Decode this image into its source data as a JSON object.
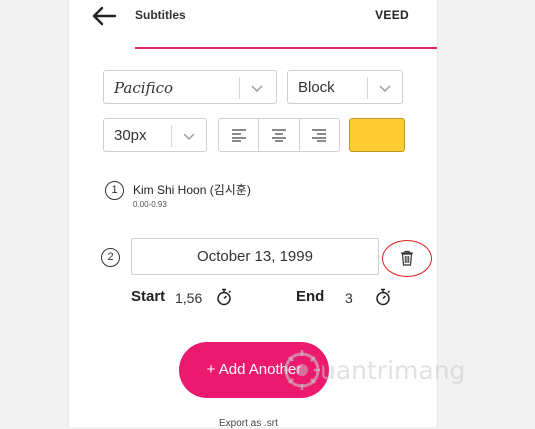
{
  "header": {
    "title": "Subtitles",
    "brand": "VEED",
    "back_icon": "arrow-left-icon",
    "accent": "#e0246e"
  },
  "style": {
    "font": "Pacifico",
    "style_option": "Block",
    "size": "30px",
    "alignment_options": [
      "align-left",
      "align-center",
      "align-right"
    ],
    "color": "#ffcc33"
  },
  "subtitles": [
    {
      "number": "1",
      "text": "Kim Shi Hoon (김시훈)",
      "time": "0.00-0.93"
    },
    {
      "number": "2",
      "text": "October 13, 1999",
      "start_label": "Start",
      "start_value": "1,56",
      "end_label": "End",
      "end_value": "3"
    }
  ],
  "actions": {
    "add_label": "+ Add Another",
    "add_color": "#ec1a6f",
    "export_label": "Export as .srt"
  },
  "watermark": {
    "text": "uantrimang"
  }
}
